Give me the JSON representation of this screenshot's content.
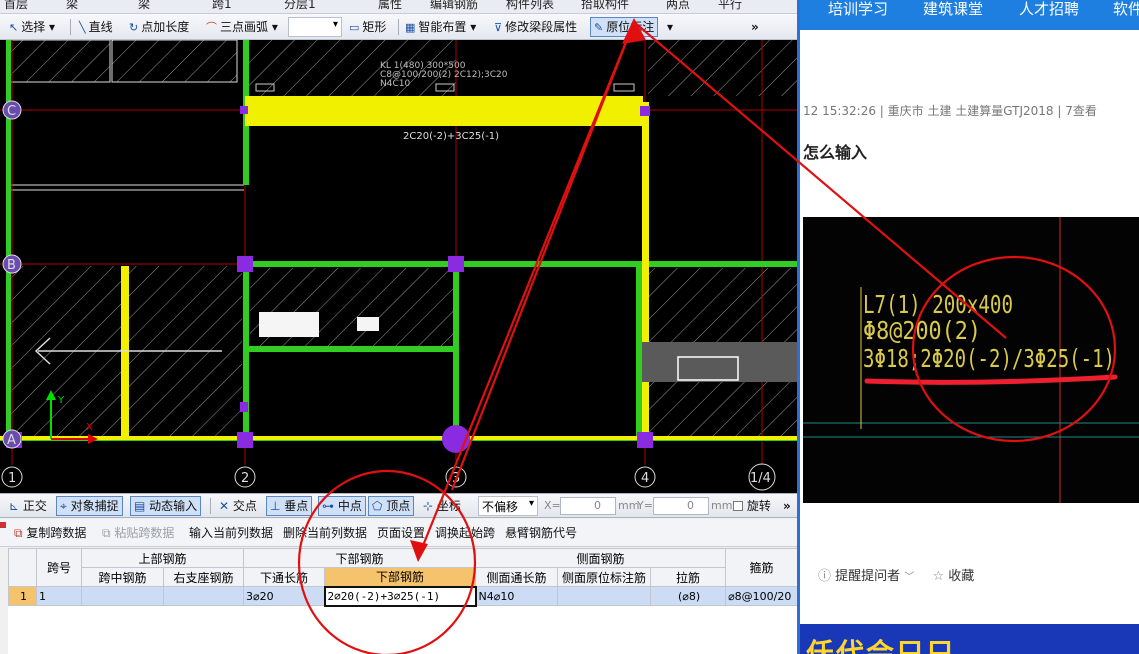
{
  "app": {
    "topstrip_fragments": [
      "首层",
      "梁",
      "梁",
      "跨1",
      "分层1",
      "属性",
      "编辑钢筋",
      "构件列表",
      "拾取构件",
      "两点",
      "平行"
    ],
    "toolbar": {
      "select": "选择",
      "line": "直线",
      "point_length": "点加长度",
      "three_point_arc": "三点画弧",
      "rect": "矩形",
      "smart_layout": "智能布置",
      "modify_span_props": "修改梁段属性",
      "in_situ_annotation": "原位标注",
      "more": "»"
    },
    "cad": {
      "axes_bottom": [
        "1",
        "2",
        "3",
        "4",
        "1/4"
      ],
      "axes_left": [
        "C",
        "B",
        "A"
      ],
      "beam_label_line1": "KL 1(480) 300*500",
      "beam_label_line2": "C8@100/200(2) 2C12);3C20",
      "beam_label_line3": "N4C10",
      "bottom_rebar_note": "2C20(-2)+3C25(-1)"
    },
    "snapbar": {
      "ortho": "正交",
      "object_snap": "对象捕捉",
      "dynamic_input": "动态输入",
      "intersection": "交点",
      "perpendicular": "垂点",
      "midpoint": "中点",
      "vertex": "顶点",
      "coordinate": "坐标",
      "offset_select": "不偏移",
      "x_label": "X=",
      "x_value": "0",
      "y_label": "Y=",
      "y_value": "0",
      "unit": "mm",
      "rotate": "旋转",
      "more": "»"
    },
    "grid_toolbar": {
      "copy_span": "复制跨数据",
      "paste_span": "粘贴跨数据",
      "input_current_col": "输入当前列数据",
      "delete_current_col": "删除当前列数据",
      "page_setup": "页面设置",
      "swap_start_span": "调换起始跨",
      "cantilever_code": "悬臂钢筋代号"
    },
    "table": {
      "group_headers": {
        "span_no": "跨号",
        "top": "上部钢筋",
        "bottom": "下部钢筋",
        "side": "侧面钢筋",
        "stirrup": "箍筋"
      },
      "columns": [
        "跨中钢筋",
        "右支座钢筋",
        "下通长筋",
        "下部钢筋",
        "侧面通长筋",
        "侧面原位标注筋",
        "拉筋"
      ],
      "rows": [
        {
          "row_no": "1",
          "span_no": "1",
          "mid": "",
          "right_support": "",
          "bottom_through": "3⌀20",
          "bottom": "2⌀20(-2)+3⌀25(-1)",
          "side_through": "N4⌀10",
          "side_in_situ": "",
          "tie": "(⌀8)",
          "stirrup": "⌀8@100/20"
        }
      ]
    }
  },
  "web": {
    "nav": [
      "培训学习",
      "建筑课堂",
      "人才招聘",
      "软件"
    ],
    "meta": "12 15:32:26   |   重庆市  土建 土建算量GTJ2018   |   7查看",
    "question_title": "怎么输入",
    "photo_text": {
      "line1": "L7(1) 200x400",
      "line2": "Φ8@200(2)",
      "line3": "3Φ18;2Φ20(-2)/3Φ25(-1)"
    },
    "remind": "提醒提问者",
    "favorite": "收藏",
    "banner": "仸代会只只"
  },
  "colors": {
    "annotation_red": "#e01010",
    "wall_green": "#33cc22",
    "beam_yellow": "#f0f000",
    "column_purple": "#8a2be2",
    "nav_blue": "#1f7fe0",
    "photo_text_yellow": "#d9c94a"
  }
}
